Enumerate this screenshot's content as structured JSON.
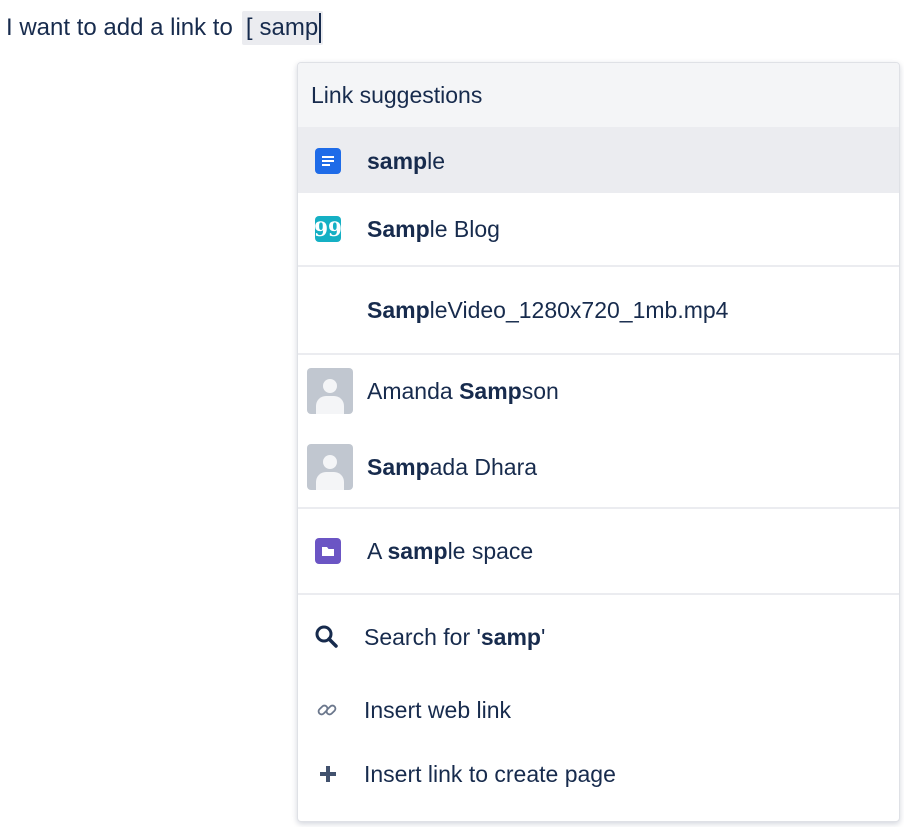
{
  "editor": {
    "prefix_text": "I want to add a link to",
    "bracket": "[",
    "query": "samp"
  },
  "dropdown": {
    "header": "Link suggestions",
    "items": [
      {
        "icon": "page-icon",
        "parts": [
          {
            "t": "samp",
            "b": true
          },
          {
            "t": "le",
            "b": false
          }
        ],
        "selected": true
      },
      {
        "icon": "blog-post-icon",
        "parts": [
          {
            "t": "Samp",
            "b": true
          },
          {
            "t": "le Blog",
            "b": false
          }
        ]
      },
      {
        "icon": "none",
        "parts": [
          {
            "t": "Samp",
            "b": true
          },
          {
            "t": "leVideo_1280x720_1mb.mp4",
            "b": false
          }
        ]
      },
      {
        "icon": "user-avatar-icon",
        "parts": [
          {
            "t": "Amanda ",
            "b": false
          },
          {
            "t": "Samp",
            "b": true
          },
          {
            "t": "son",
            "b": false
          }
        ]
      },
      {
        "icon": "user-avatar-icon",
        "parts": [
          {
            "t": "Samp",
            "b": true
          },
          {
            "t": "ada Dhara",
            "b": false
          }
        ]
      },
      {
        "icon": "space-icon",
        "parts": [
          {
            "t": "A ",
            "b": false
          },
          {
            "t": "samp",
            "b": true
          },
          {
            "t": "le space",
            "b": false
          }
        ]
      },
      {
        "icon": "search-icon",
        "parts": [
          {
            "t": "Search for '",
            "b": false
          },
          {
            "t": "samp",
            "b": true
          },
          {
            "t": "'",
            "b": false
          }
        ]
      },
      {
        "icon": "link-icon",
        "parts": [
          {
            "t": "Insert web link",
            "b": false
          }
        ]
      },
      {
        "icon": "plus-icon",
        "parts": [
          {
            "t": "Insert link to create page",
            "b": false
          }
        ]
      }
    ]
  },
  "colors": {
    "page_icon": "#1e6be8",
    "blog_icon": "#15b0c4",
    "space_icon": "#6b55c4",
    "selected_bg": "#ebecf0",
    "text": "#172b4d"
  }
}
